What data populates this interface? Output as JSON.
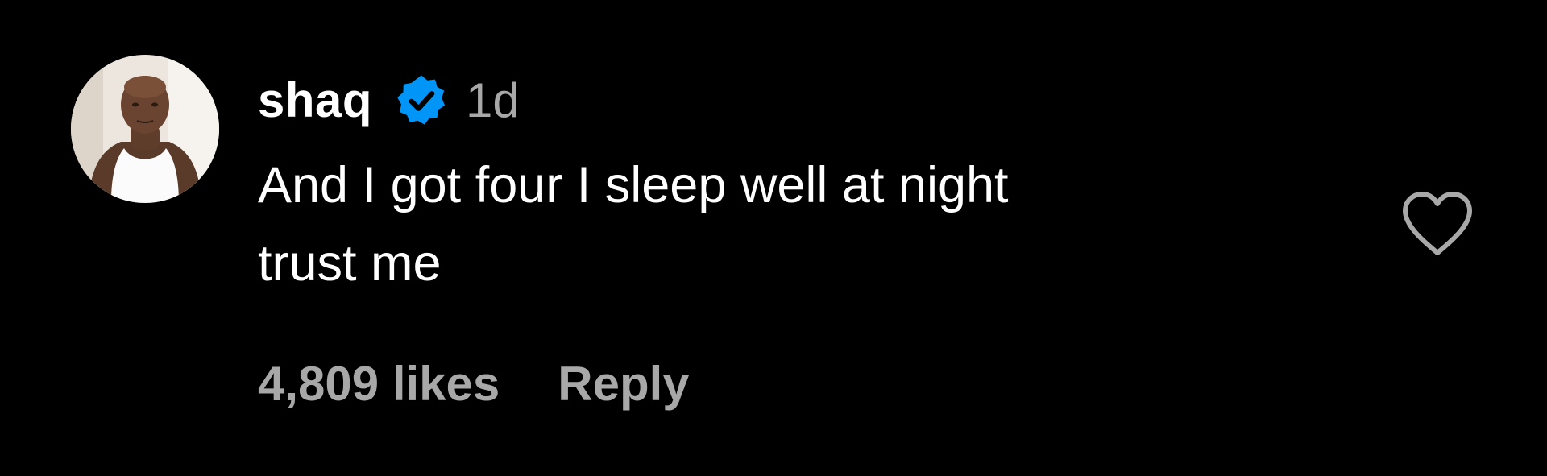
{
  "comment": {
    "username": "shaq",
    "verified": true,
    "time_ago": "1d",
    "text": "And I got four I sleep well at night\ntrust me",
    "likes_label": "4,809 likes",
    "reply_label": "Reply"
  },
  "colors": {
    "background": "#000000",
    "primary_text": "#ffffff",
    "secondary_text": "#a8a8a8",
    "verified_badge": "#0095f6",
    "heart_outline": "#a8a8a8"
  },
  "icons": {
    "verified": "verified-badge-icon",
    "like": "heart-outline-icon",
    "avatar": "profile-photo"
  }
}
